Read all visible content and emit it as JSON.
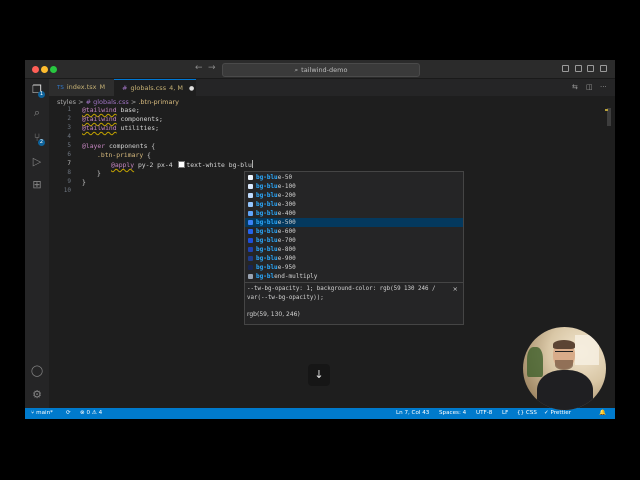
{
  "window": {
    "title": "tailwind-demo"
  },
  "tabs": [
    {
      "icon": "TS",
      "name": "index.tsx",
      "status": "M"
    },
    {
      "icon": "#",
      "name": "globals.css",
      "status": "4, M",
      "dirty": "●"
    }
  ],
  "breadcrumb": {
    "folder": "styles",
    "sep1": ">",
    "file": "# globals.css",
    "sep2": ">",
    "symbol": ".btn-primary"
  },
  "line_numbers": [
    "1",
    "2",
    "3",
    "4",
    "5",
    "6",
    "7",
    "8",
    "9",
    "10"
  ],
  "code": {
    "l1_kw": "@tailwind",
    "l1_rest": " base;",
    "l2_kw": "@tailwind",
    "l2_rest": " components;",
    "l3_kw": "@tailwind",
    "l3_rest": " utilities;",
    "l5_kw": "@layer",
    "l5_rest": " components {",
    "l6_sel": ".btn-primary",
    "l6_rest": " {",
    "l7_kw": "@apply",
    "l7_a": " py-2 px-4 ",
    "l7_b": "text-white bg-blu",
    "l8": "}",
    "l9": "}"
  },
  "suggestions": [
    {
      "label_match": "bg-blu",
      "label_rest": "e-50",
      "color": "#eff6ff"
    },
    {
      "label_match": "bg-blu",
      "label_rest": "e-100",
      "color": "#dbeafe"
    },
    {
      "label_match": "bg-blu",
      "label_rest": "e-200",
      "color": "#bfdbfe"
    },
    {
      "label_match": "bg-blu",
      "label_rest": "e-300",
      "color": "#93c5fd"
    },
    {
      "label_match": "bg-blu",
      "label_rest": "e-400",
      "color": "#60a5fa"
    },
    {
      "label_match": "bg-blu",
      "label_rest": "e-500",
      "color": "#3b82f6",
      "selected": true
    },
    {
      "label_match": "bg-blu",
      "label_rest": "e-600",
      "color": "#2563eb"
    },
    {
      "label_match": "bg-blu",
      "label_rest": "e-700",
      "color": "#1d4ed8"
    },
    {
      "label_match": "bg-blu",
      "label_rest": "e-800",
      "color": "#1e40af"
    },
    {
      "label_match": "bg-blu",
      "label_rest": "e-900",
      "color": "#1e3a8a"
    },
    {
      "label_match": "bg-blu",
      "label_rest": "e-950",
      "color": "#172554"
    },
    {
      "label_match": "bg-bl",
      "label_rest": "end-multiply",
      "color": "#9aa4b2"
    }
  ],
  "details": {
    "doc": "--tw-bg-opacity: 1; background-color: rgb(59 130 246 / var(--tw-bg-opacity));",
    "rgb": "rgb(59, 130, 246)",
    "close": "×"
  },
  "statusbar": {
    "branch": "main*",
    "sync": "⟳",
    "problems": "⊗ 0 ⚠ 4",
    "cursor": "Ln 7, Col 43",
    "spaces": "Spaces: 4",
    "encoding": "UTF-8",
    "eol": "LF",
    "language": "{} CSS",
    "formatter": "✓ Prettier",
    "bell": "🔔"
  },
  "badges": {
    "explorer": "1",
    "scm": "2"
  },
  "overlay": {
    "arrow": "↓"
  }
}
